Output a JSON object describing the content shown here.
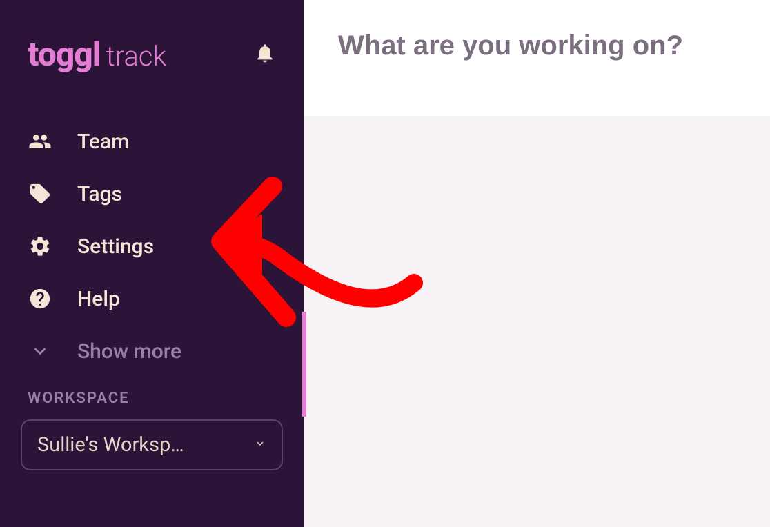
{
  "logo": {
    "brand": "toggl",
    "product": "track"
  },
  "sidebar": {
    "items": [
      {
        "label": "Team",
        "icon": "team-icon"
      },
      {
        "label": "Tags",
        "icon": "tags-icon"
      },
      {
        "label": "Settings",
        "icon": "gear-icon"
      },
      {
        "label": "Help",
        "icon": "help-icon"
      },
      {
        "label": "Show more",
        "icon": "chevron-down-icon",
        "muted": true
      }
    ]
  },
  "workspace": {
    "heading": "WORKSPACE",
    "selected": "Sullie's Worksp…"
  },
  "main": {
    "placeholder": "What are you working on?"
  }
}
